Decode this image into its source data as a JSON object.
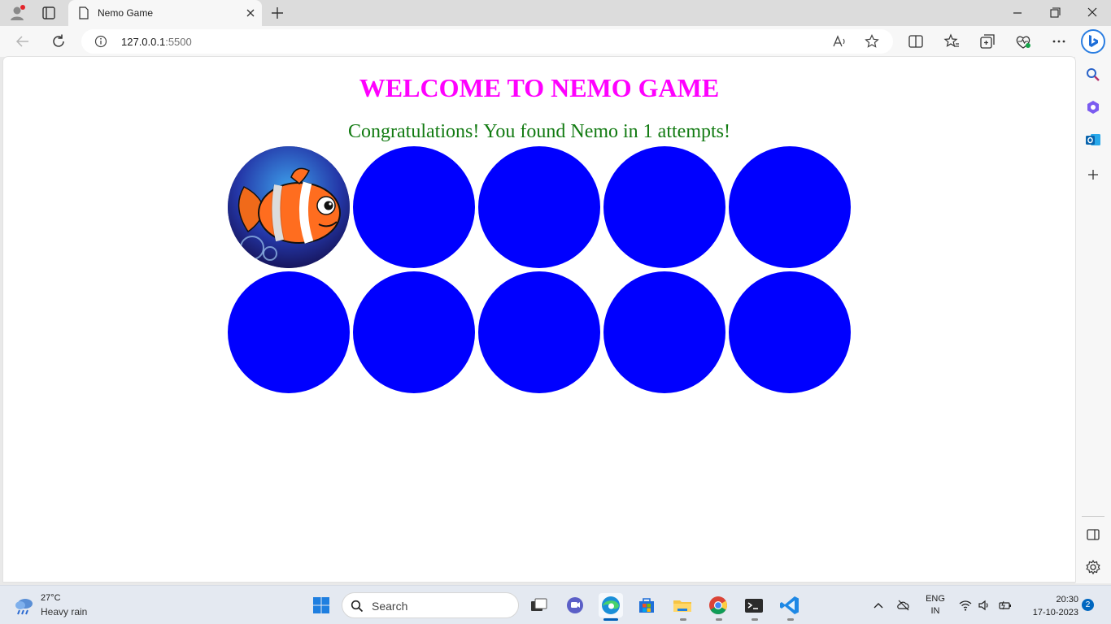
{
  "browser": {
    "tab_title": "Nemo Game",
    "url_host": "127.0.0.1",
    "url_port": ":5500"
  },
  "page": {
    "heading": "WELCOME TO NEMO GAME",
    "message": "Congratulations! You found Nemo in 1 attempts!",
    "circles": [
      {
        "state": "nemo"
      },
      {
        "state": "hidden"
      },
      {
        "state": "hidden"
      },
      {
        "state": "hidden"
      },
      {
        "state": "hidden"
      },
      {
        "state": "hidden"
      },
      {
        "state": "hidden"
      },
      {
        "state": "hidden"
      },
      {
        "state": "hidden"
      },
      {
        "state": "hidden"
      }
    ],
    "circle_color": "#0000ff",
    "heading_color": "#ff00ff",
    "message_color": "#117a11"
  },
  "taskbar": {
    "weather_temp": "27°C",
    "weather_desc": "Heavy rain",
    "search_label": "Search",
    "lang_line1": "ENG",
    "lang_line2": "IN",
    "time": "20:30",
    "date": "17-10-2023",
    "notification_count": "2"
  }
}
